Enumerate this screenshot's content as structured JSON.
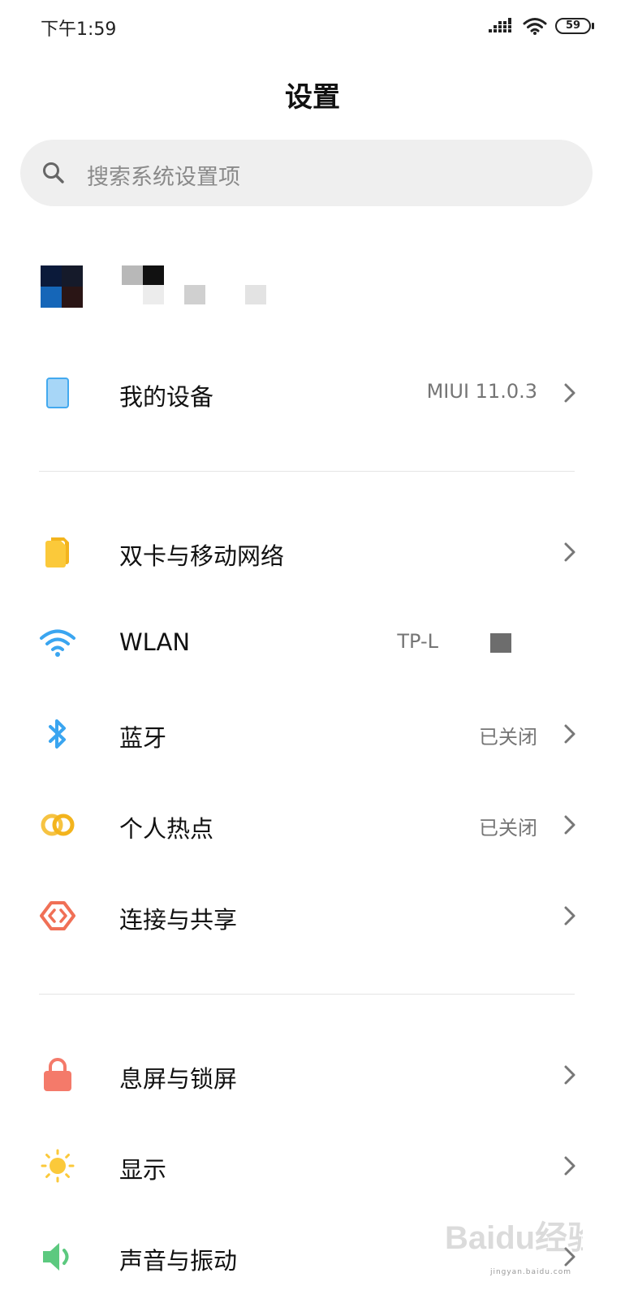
{
  "status_bar": {
    "time": "下午1:59",
    "battery": "59"
  },
  "header": {
    "title": "设置"
  },
  "search": {
    "placeholder": "搜索系统设置项"
  },
  "sections": {
    "device": {
      "label": "我的设备",
      "value": "MIUI 11.0.3",
      "icon": "tablet-icon"
    },
    "network": [
      {
        "label": "双卡与移动网络",
        "value": "",
        "icon": "sim-card-icon"
      },
      {
        "label": "WLAN",
        "value": "TP-L",
        "icon": "wifi-icon"
      },
      {
        "label": "蓝牙",
        "value": "已关闭",
        "icon": "bluetooth-icon"
      },
      {
        "label": "个人热点",
        "value": "已关闭",
        "icon": "hotspot-icon"
      },
      {
        "label": "连接与共享",
        "value": "",
        "icon": "share-icon"
      }
    ],
    "display": [
      {
        "label": "息屏与锁屏",
        "value": "",
        "icon": "lock-icon"
      },
      {
        "label": "显示",
        "value": "",
        "icon": "sun-icon"
      },
      {
        "label": "声音与振动",
        "value": "",
        "icon": "speaker-icon"
      }
    ]
  },
  "watermark": {
    "text": "jingyan.baidu.com",
    "logo": "Baidu经验"
  },
  "colors": {
    "device_icon": "#9fd0f5",
    "sim_icon": "#f9c23c",
    "wifi_icon": "#3aa5f0",
    "bluetooth_icon": "#3aa5f0",
    "hotspot_icon": "#f6c342",
    "share_icon": "#f07056",
    "lock_icon": "#f47a6a",
    "sun_icon": "#f9c23c",
    "speaker_icon": "#5cc97f"
  }
}
